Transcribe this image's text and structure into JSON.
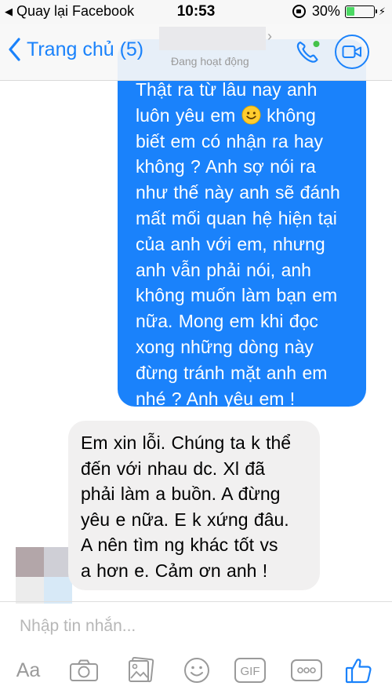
{
  "status_bar": {
    "back_app_label": "Quay lại Facebook",
    "time": "10:53",
    "battery_percent": "30%",
    "battery_level": 0.3
  },
  "nav": {
    "back_label": "Trang chủ (5)",
    "subtitle": "Đang hoạt động",
    "accent_color": "#1a82fb"
  },
  "messages": {
    "sent": {
      "line_0": "Thật ra từ lâu nay anh",
      "line_1a": "luôn yêu em",
      "line_1b": "không",
      "line_2": "biết em có nhận ra hay",
      "line_3": "không ? Anh sợ nói ra",
      "line_4": "như thế này anh sẽ đánh",
      "line_5": "mất mối quan hệ hiện tại",
      "line_6": "của anh với em, nhưng",
      "line_7": "anh vẫn phải nói, anh",
      "line_8": "không muốn làm bạn em",
      "line_9": "nữa. Mong em khi đọc",
      "line_10": "xong những dòng này",
      "line_11": "đừng tránh mặt anh em",
      "line_12": "nhé ? Anh yêu em !",
      "bubble_color": "#1a82fb"
    },
    "received": {
      "line_0": "Em xin lỗi. Chúng ta k thể",
      "line_1": "đến với nhau dc. Xl đã",
      "line_2": "phải làm a buồn. A đừng",
      "line_3": "yêu e nữa. E k xứng đâu.",
      "line_4": "A nên tìm ng khác tốt vs",
      "line_5": "a hơn e. Cảm ơn anh !",
      "bubble_color": "#f1f0f0"
    }
  },
  "composer": {
    "placeholder": "Nhập tin nhắn...",
    "toolbar": {
      "aa_label": "Aa",
      "gif_label": "GIF"
    }
  },
  "icons": [
    "back-chevron-icon",
    "phone-icon",
    "video-camera-icon",
    "smiley-icon",
    "camera-icon",
    "photo-icon",
    "emoji-icon",
    "gif-icon",
    "more-icon",
    "like-icon"
  ]
}
